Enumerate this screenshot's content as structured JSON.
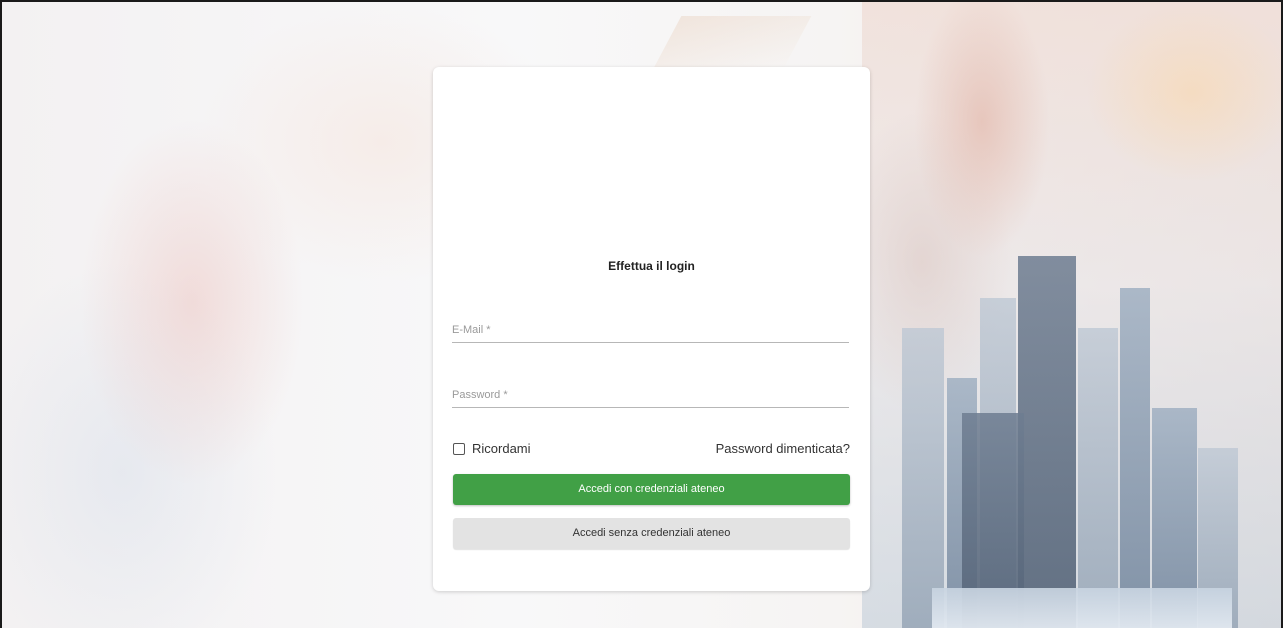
{
  "login": {
    "title": "Effettua il login",
    "email": {
      "placeholder": "E-Mail *",
      "value": ""
    },
    "password": {
      "placeholder": "Password *",
      "value": ""
    },
    "remember_label": "Ricordami",
    "remember_checked": false,
    "forgot_label": "Password dimenticata?",
    "primary_button": "Accedi con credenziali ateneo",
    "secondary_button": "Accedi senza credenziali ateneo"
  },
  "colors": {
    "primary": "#41a046",
    "secondary": "#e3e3e3",
    "card": "#ffffff"
  }
}
